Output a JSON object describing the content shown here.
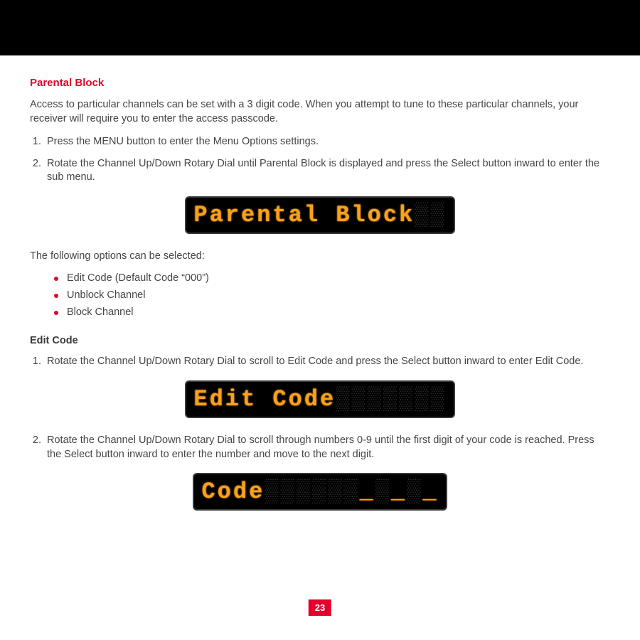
{
  "title": "Parental Block",
  "intro": "Access to particular channels can be set with a 3 digit code. When you attempt to tune to these particular channels, your receiver will require you to enter the access passcode.",
  "steps_a": [
    "Press the MENU button to enter the Menu Options settings.",
    "Rotate the Channel Up/Down Rotary Dial until Parental Block is displayed and press the Select button inward to enter the sub menu."
  ],
  "lcd1_text": "Parental Block",
  "options_lead": "The following options can be selected:",
  "options": [
    "Edit Code (Default Code “000”)",
    "Unblock Channel",
    "Block Channel"
  ],
  "editcode_heading": "Edit Code",
  "steps_b1": "Rotate the Channel Up/Down Rotary Dial to scroll to Edit Code and press the Select button inward to enter Edit Code.",
  "lcd2_text": "Edit Code",
  "steps_b2": "Rotate the Channel Up/Down Rotary Dial to scroll through numbers 0-9 until the first digit of your code is reached. Press the Select button inward to enter the number and move to the next digit.",
  "lcd3_label": "Code",
  "page_number": "23"
}
